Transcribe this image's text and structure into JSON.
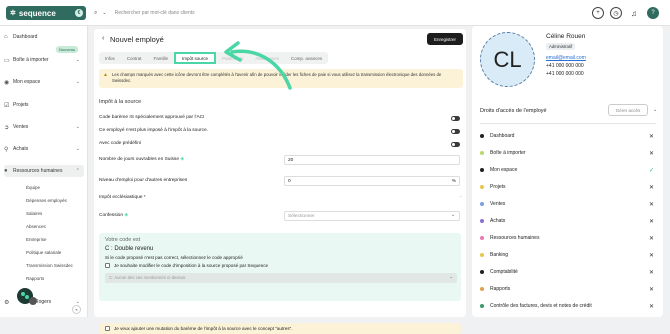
{
  "app": {
    "brand": "sequence",
    "brand_badge": "€"
  },
  "search": {
    "placeholder": "Rechercher par mot-clé dans clients"
  },
  "sidebar": {
    "items": [
      {
        "label": "Dashboard",
        "icon": "home-icon"
      },
      {
        "label": "Boîte à importer",
        "icon": "inbox-icon",
        "badge": "Nouveau"
      },
      {
        "label": "Mon espace",
        "icon": "user-icon"
      },
      {
        "label": "Projets",
        "icon": "check-square-icon"
      },
      {
        "label": "Ventes",
        "icon": "arrow-right-circle-icon"
      },
      {
        "label": "Achats",
        "icon": "cart-icon"
      },
      {
        "label": "Ressources humaines",
        "icon": "people-icon"
      }
    ],
    "sub_items": [
      "Équipe",
      "Dépenses employés",
      "Salaires",
      "Absences",
      "Entreprise",
      "Politique salariale",
      "Transmission Swissdec",
      "Rapports"
    ],
    "bottom": {
      "label": "Rogers",
      "icon": "gear-icon"
    }
  },
  "page": {
    "title": "Nouvel employé",
    "save_label": "Enregistrer",
    "tabs": [
      "Infos",
      "Contrat",
      "Famille",
      "Impôt source",
      "Paiements",
      "Assurances",
      "Comp. avances"
    ],
    "active_tab": 3,
    "alert": "Les champs marqués avec cette icône devront être complétés à l'avenir afin de pouvoir valider les fiches de paie si vous utilisez la transmission électronique des données de Swissdec.",
    "section_title": "Impôt à la source",
    "toggles": [
      {
        "label": "Code barème IS spécialement approuvé par l'ACI"
      },
      {
        "label": "Ce employé n'est plus imposé à l'impôt à la source."
      },
      {
        "label": "Avec code prédéfini"
      }
    ],
    "fields": [
      {
        "label": "Nombre de jours ouvrables en Suisse",
        "value": "20",
        "unit": ""
      },
      {
        "label": "Niveau d'emploi pour d'autres entreprises",
        "value": "0",
        "unit": "%"
      },
      {
        "label": "Impôt ecclésiastique *",
        "value": "-"
      },
      {
        "label": "Confession",
        "value": "Sélectionner"
      }
    ],
    "code": {
      "title": "Votre code est",
      "value": "C : Double revenu",
      "hint": "Si le code proposé n'est pas correct, sélectionnez le code approprié",
      "checkbox_label": "Je souhaite modifier le code d'imposition à la source proposé par Sequence",
      "select_placeholder": "C: Aucun des cas mentionnés ci-dessus."
    },
    "mutation_label": "Je veux ajouter une mutation du barème de l'impôt à la source avec le concept \"autres\"."
  },
  "profile": {
    "initials": "CL",
    "name": "Céline Rouen",
    "role": "Administratif",
    "email": "email@email.com",
    "phone1": "+41 000 000 000",
    "phone2": "+41 000 000 000"
  },
  "access": {
    "title": "Droits d'accès de l'employé",
    "manage_label": "Gérer accès",
    "items": [
      {
        "label": "Dashboard",
        "color": "#222222",
        "granted": false
      },
      {
        "label": "Boîte à importer",
        "color": "#b9d86b",
        "granted": false
      },
      {
        "label": "Mon espace",
        "color": "#222222",
        "granted": true
      },
      {
        "label": "Projets",
        "color": "#e6c84d",
        "granted": false
      },
      {
        "label": "Ventes",
        "color": "#7b9fe0",
        "granted": false
      },
      {
        "label": "Achats",
        "color": "#8a6fd6",
        "granted": false
      },
      {
        "label": "Ressources humaines",
        "color": "#e879b0",
        "granted": false
      },
      {
        "label": "Banking",
        "color": "#e6c84d",
        "granted": false
      },
      {
        "label": "Comptabilité",
        "color": "#222222",
        "granted": false
      },
      {
        "label": "Rapports",
        "color": "#e0a04d",
        "granted": false
      },
      {
        "label": "Contrôle des factures, devis et notes de crédit",
        "color": "#3a9a6a",
        "granted": false
      }
    ]
  },
  "colors": {
    "brand": "#2f6b5e",
    "accent": "#4bd6a5",
    "alert_bg": "#fbf2d7",
    "code_bg": "#e9f8f2"
  }
}
